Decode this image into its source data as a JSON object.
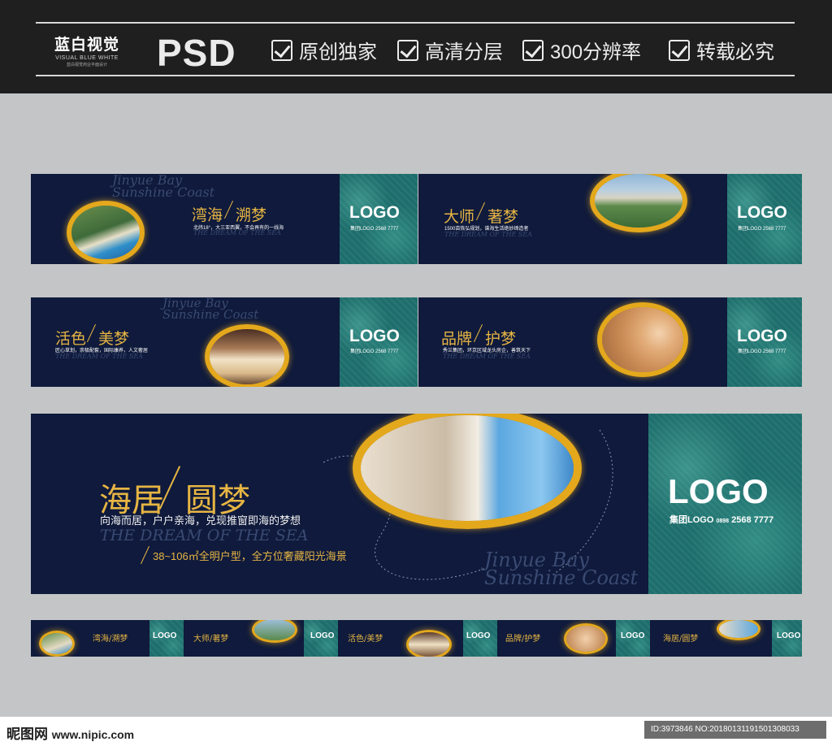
{
  "header": {
    "brand_cn": "蓝白视觉",
    "brand_en": "VISUAL BLUE WHITE",
    "brand_tag": "蓝白视觉商业平面设计",
    "psd": "PSD",
    "features": [
      "原创独家",
      "高清分层",
      "300分辨率",
      "转载必究"
    ]
  },
  "common": {
    "logo": "LOGO",
    "group_logo": "集团LOGO",
    "phone": "2568 7777",
    "tel_prefix": "0898",
    "english_tag": "THE DREAM OF THE SEA",
    "bay_line1": "Jinyue Bay",
    "bay_line2": "Sunshine Coast"
  },
  "banners": [
    {
      "title_a": "湾海",
      "title_b": "溯梦",
      "desc": "北纬18°，大三亚西翼，不会再有的一线海"
    },
    {
      "title_a": "大师",
      "title_b": "著梦",
      "desc": "1500亩恢弘规划，谱海生活绝妙缔造者"
    },
    {
      "title_a": "活色",
      "title_b": "美梦",
      "desc": "匠心草划，崇极配套，国际康养，人文奢居"
    },
    {
      "title_a": "品牌",
      "title_b": "护梦",
      "desc": "秀兰集团，环京区域龙头房企，善筑天下"
    }
  ],
  "large": {
    "title_a": "海居",
    "title_b": "圆梦",
    "line1": "向海而居，户户亲海，兑现推窗即海的梦想",
    "line2": "38~106㎡全明户型，全方位奢藏阳光海景"
  },
  "mini": [
    {
      "title": "湾海/溯梦"
    },
    {
      "title": "大师/著梦"
    },
    {
      "title": "活色/美梦"
    },
    {
      "title": "品牌/护梦"
    },
    {
      "title": "海居/圆梦"
    }
  ],
  "footer": {
    "site_cn": "昵图网",
    "site_url": "www.nipic.com",
    "id_text": "ID:3973846 NO:20180131191501308033"
  }
}
